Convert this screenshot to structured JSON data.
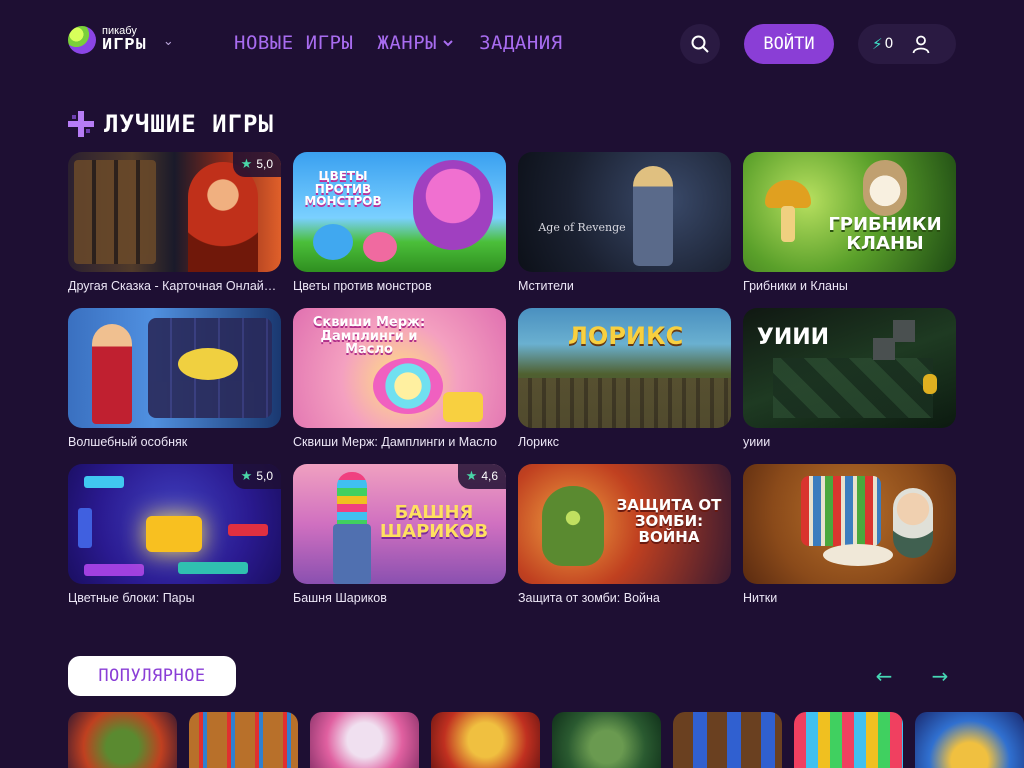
{
  "header": {
    "logo_small": "пикабу",
    "logo_big": "ИГРЫ",
    "nav": [
      {
        "label": "НОВЫЕ ИГРЫ"
      },
      {
        "label": "ЖАНРЫ"
      },
      {
        "label": "ЗАДАНИЯ"
      }
    ],
    "login_label": "ВОЙТИ",
    "coins": "0"
  },
  "best": {
    "title": "ЛУЧШИЕ ИГРЫ",
    "cards": [
      {
        "title": "Другая Сказка - Карточная Онлайн Игра",
        "rating": "5,0"
      },
      {
        "title": "Цветы против монстров",
        "rating": "",
        "art_text": "ЦВЕТЫ ПРОТИВ МОНСТРОВ"
      },
      {
        "title": "Мстители",
        "rating": "",
        "art_text": "Age of Revenge"
      },
      {
        "title": "Грибники и Кланы",
        "rating": "",
        "art_text": "ГРИБНИКИ КЛАНЫ"
      },
      {
        "title": "Волшебный особняк",
        "rating": ""
      },
      {
        "title": "Сквиши Мерж: Дамплинги и Масло",
        "rating": "",
        "art_text": "Сквиши Мерж: Дамплинги и Масло"
      },
      {
        "title": "Лорикс",
        "rating": "",
        "art_text": "ЛОРИКС"
      },
      {
        "title": "уиии",
        "rating": "",
        "art_text": "УИИИ"
      },
      {
        "title": "Цветные блоки: Пары",
        "rating": "5,0"
      },
      {
        "title": "Башня Шариков",
        "rating": "4,6",
        "art_text": "БАШНЯ ШАРИКОВ"
      },
      {
        "title": "Защита от зомби: Война",
        "rating": "",
        "art_text": "ЗАЩИТА ОТ ЗОМБИ: ВОЙНА"
      },
      {
        "title": "Нитки",
        "rating": ""
      }
    ]
  },
  "popular": {
    "title": "ПОПУЛЯРНОЕ",
    "prev": "←",
    "next": "→"
  },
  "colors": {
    "background": "#1e0f33",
    "accent": "#8a3ed6",
    "nav": "#a86cf0",
    "teal": "#46d8b5"
  }
}
